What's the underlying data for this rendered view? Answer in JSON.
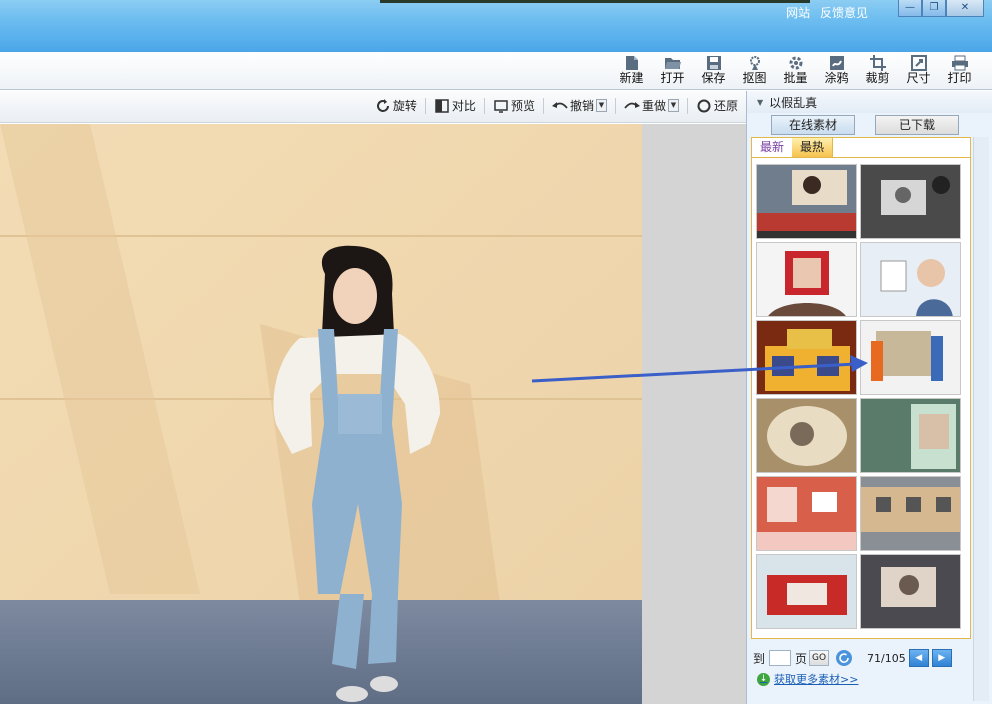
{
  "titlebar": {
    "links": [
      "网站",
      "反馈意见"
    ]
  },
  "window_buttons": [
    {
      "name": "minimize-button",
      "icon": "minimize-icon",
      "glyph": "—"
    },
    {
      "name": "restore-button",
      "icon": "restore-icon",
      "glyph": "❐"
    },
    {
      "name": "close-button",
      "icon": "close-icon",
      "glyph": "✕"
    }
  ],
  "toolbar": {
    "items": [
      {
        "label": "新建",
        "icon": "new-file-icon"
      },
      {
        "label": "打开",
        "icon": "folder-open-icon"
      },
      {
        "label": "保存",
        "icon": "save-icon"
      },
      {
        "label": "抠图",
        "icon": "cutout-icon"
      },
      {
        "label": "批量",
        "icon": "batch-icon"
      },
      {
        "label": "涂鸦",
        "icon": "doodle-icon"
      },
      {
        "label": "裁剪",
        "icon": "crop-icon"
      },
      {
        "label": "尺寸",
        "icon": "resize-icon"
      },
      {
        "label": "打印",
        "icon": "print-icon"
      }
    ]
  },
  "subbar": {
    "rotate": "旋转",
    "compare": "对比",
    "preview": "预览",
    "undo": "撤销",
    "redo": "重做",
    "restore": "还原"
  },
  "panel": {
    "title": "以假乱真",
    "tabs": [
      "在线素材",
      "已下载"
    ],
    "subtabs": [
      "最新",
      "最热"
    ],
    "pager": {
      "to": "到",
      "page": "页",
      "go": "GO",
      "count": "71/105"
    },
    "more_link": "获取更多素材>>"
  },
  "colors": {
    "titlebar": "#6bbcf0",
    "panel_border": "#e2b84a",
    "arrow": "#3a5fc8"
  }
}
